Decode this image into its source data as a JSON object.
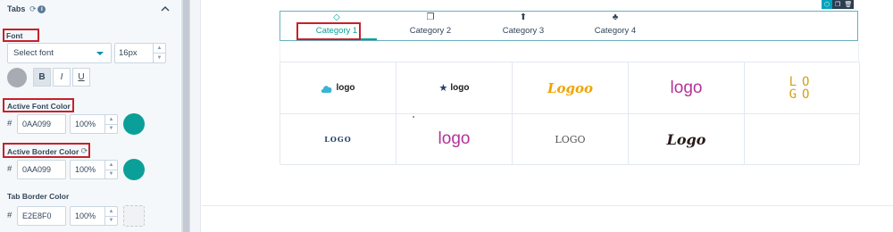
{
  "panel": {
    "title": "Tabs",
    "font_label": "Font",
    "font_select": "Select font",
    "font_size": "16px",
    "format_buttons": {
      "bold": "B",
      "italic": "I",
      "underline": "U"
    },
    "active_font_color": {
      "label": "Active Font Color",
      "hash": "#",
      "hex": "0AA099",
      "opacity": "100%",
      "swatch": "#0AA099"
    },
    "active_border_color": {
      "label": "Active Border Color",
      "hash": "#",
      "hex": "0AA099",
      "opacity": "100%",
      "swatch": "#0AA099"
    },
    "tab_border_color": {
      "label": "Tab Border Color",
      "hash": "#",
      "hex": "E2E8F0",
      "opacity": "100%"
    },
    "default_color_swatch": "#a7acb3"
  },
  "tabs": [
    {
      "label": "Category 1",
      "icon": "gem-icon",
      "glyph": "◇",
      "active": true
    },
    {
      "label": "Category 2",
      "icon": "copy-icon",
      "glyph": "❐",
      "active": false
    },
    {
      "label": "Category 3",
      "icon": "arrow-up-circle-icon",
      "glyph": "⬆",
      "active": false
    },
    {
      "label": "Category 4",
      "icon": "dragon-icon",
      "glyph": "♣",
      "active": false
    }
  ],
  "accent_color": "#0AA099",
  "highlight_color": "#c8202a",
  "logos": [
    {
      "text": "logo",
      "color": "#222222",
      "style": "cloud"
    },
    {
      "text": "logo",
      "color": "#1a1a1a",
      "style": "star"
    },
    {
      "text": "Logoo",
      "color": "#f0a500",
      "style": "script"
    },
    {
      "text": "logo",
      "color": "#b3339a",
      "style": "plain"
    },
    {
      "text": "LOGO",
      "color": "#d4a017",
      "style": "stacked"
    },
    {
      "text": "LOGO",
      "color": "#1f3f66",
      "style": "serif-small"
    },
    {
      "text": "logo",
      "color": "#b3339a",
      "style": "plain"
    },
    {
      "text": "LOGO",
      "color": "#555555",
      "style": "serif"
    },
    {
      "text": "Logo",
      "color": "#2a1a1a",
      "style": "script-dark"
    },
    {
      "text": "",
      "color": "",
      "style": "empty"
    }
  ]
}
